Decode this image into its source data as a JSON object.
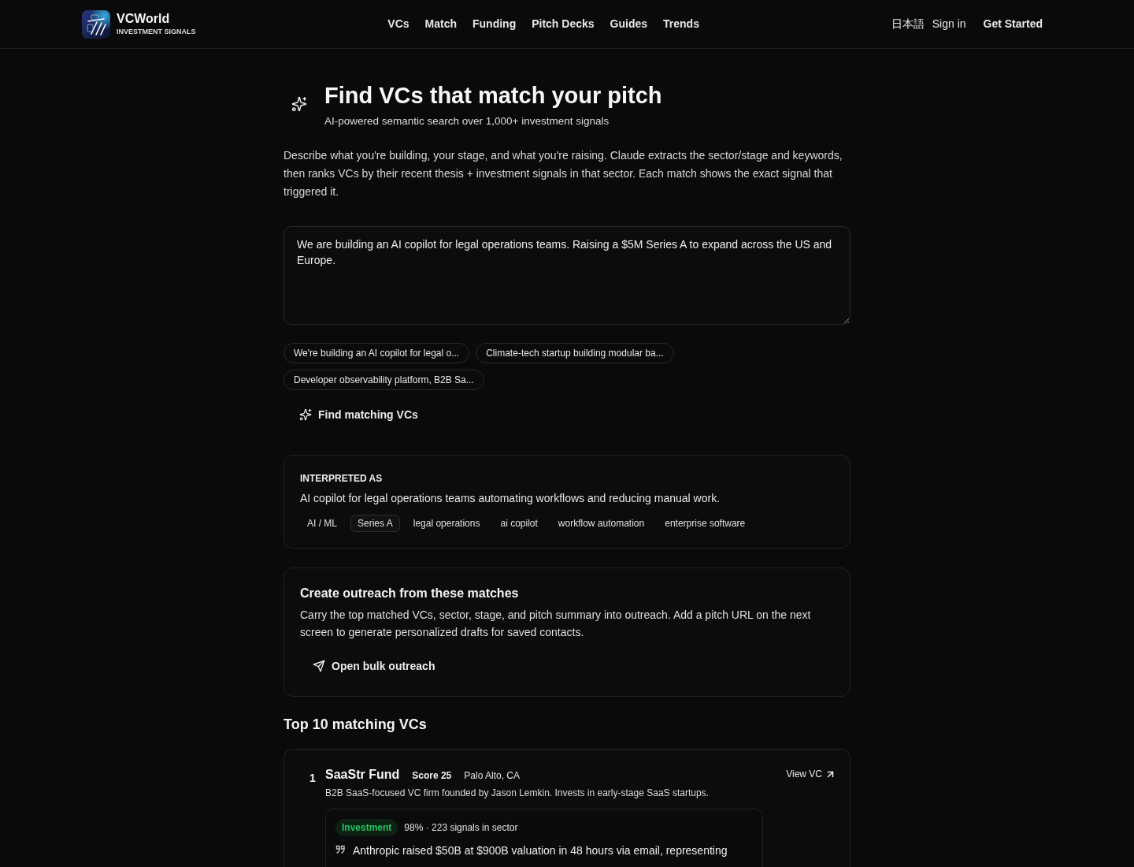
{
  "brand": {
    "name": "VCWorld",
    "tagline": "INVESTMENT SIGNALS"
  },
  "nav": {
    "links": [
      "VCs",
      "Match",
      "Funding",
      "Pitch Decks",
      "Guides",
      "Trends"
    ],
    "language": "日本語",
    "sign_in": "Sign in",
    "get_started": "Get Started"
  },
  "hero": {
    "title": "Find VCs that match your pitch",
    "subtitle": "AI-powered semantic search over 1,000+ investment signals",
    "description": "Describe what you're building, your stage, and what you're raising. Claude extracts the sector/stage and keywords, then ranks VCs by their recent thesis + investment signals in that sector. Each match shows the exact signal that triggered it."
  },
  "pitch_input": {
    "value": "We are building an AI copilot for legal operations teams. Raising a $5M Series A to expand across the US and Europe."
  },
  "examples": [
    "We're building an AI copilot for legal o...",
    "Climate-tech startup building modular ba...",
    "Developer observability platform, B2B Sa..."
  ],
  "find_button": "Find matching VCs",
  "interpretation": {
    "heading": "INTERPRETED AS",
    "summary": "AI copilot for legal operations teams automating workflows and reducing manual work.",
    "tags": [
      {
        "label": "AI / ML",
        "kind": "sector"
      },
      {
        "label": "Series A",
        "kind": "stage"
      },
      {
        "label": "legal operations",
        "kind": "keyword"
      },
      {
        "label": "ai copilot",
        "kind": "keyword"
      },
      {
        "label": "workflow automation",
        "kind": "keyword"
      },
      {
        "label": "enterprise software",
        "kind": "keyword"
      }
    ]
  },
  "outreach": {
    "title": "Create outreach from these matches",
    "description": "Carry the top matched VCs, sector, stage, and pitch summary into outreach. Add a pitch URL on the next screen to generate personalized drafts for saved contacts.",
    "button": "Open bulk outreach"
  },
  "results": {
    "heading": "Top 10 matching VCs",
    "matches": [
      {
        "rank": "1",
        "name": "SaaStr Fund",
        "score": "Score 25",
        "location": "Palo Alto, CA",
        "link": "View VC",
        "description": "B2B SaaS-focused VC firm founded by Jason Lemkin. Invests in early-stage SaaS startups.",
        "signals": [
          {
            "type": "Investment",
            "color": "#22c55e",
            "stats": "98% · 223 signals in sector",
            "quote": "Anthropic raised $50B at $900B valuation in 48 hours via email, representing"
          }
        ]
      }
    ]
  }
}
